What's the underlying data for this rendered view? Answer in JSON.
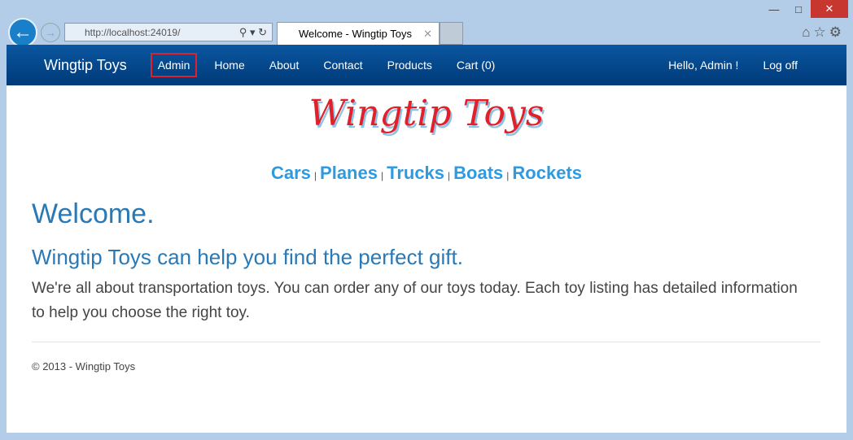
{
  "browser": {
    "url_host": "http://localhost",
    "url_port": ":24019/",
    "tab_title": "Welcome - Wingtip Toys"
  },
  "nav": {
    "brand": "Wingtip Toys",
    "items": [
      "Admin",
      "Home",
      "About",
      "Contact",
      "Products",
      "Cart (0)"
    ],
    "greeting": "Hello, Admin !",
    "logoff": "Log off"
  },
  "logo": "Wingtip Toys",
  "categories": [
    "Cars",
    "Planes",
    "Trucks",
    "Boats",
    "Rockets"
  ],
  "separator": "|",
  "main": {
    "title": "Welcome.",
    "subtitle": "Wingtip Toys can help you find the perfect gift.",
    "lead": "We're all about transportation toys. You can order any of our toys today. Each toy listing has detailed information to help you choose the right toy."
  },
  "footer": "© 2013 - Wingtip Toys",
  "colors": {
    "navbar": "#0a56a0",
    "accent": "#2e9ae0",
    "heading": "#2a79b5",
    "highlight": "#e0202a"
  }
}
